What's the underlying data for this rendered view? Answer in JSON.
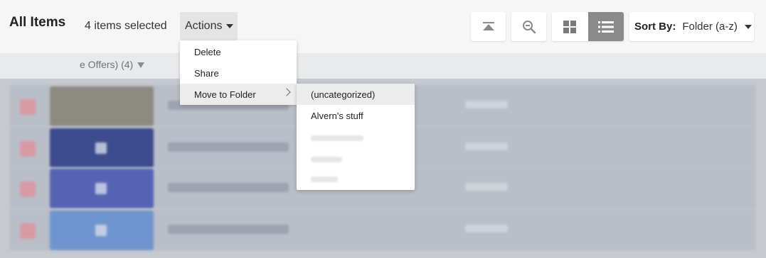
{
  "header": {
    "title": "All Items",
    "selection_count": "4 items selected",
    "actions_label": "Actions"
  },
  "toolbar": {
    "scroll_top_icon": "scroll-to-top-icon",
    "zoom_icon": "zoom-out-icon",
    "grid_view_icon": "grid-view-icon",
    "list_view_icon": "list-view-icon",
    "active_view": "list",
    "sort_label": "Sort By:",
    "sort_value": "Folder (a-z)"
  },
  "group": {
    "label": "e Offers) (4)"
  },
  "actions_menu": {
    "items": [
      {
        "label": "Delete"
      },
      {
        "label": "Share"
      },
      {
        "label": "Move to Folder"
      }
    ]
  },
  "folder_menu": {
    "items": [
      {
        "label": "(uncategorized)"
      },
      {
        "label": "Alvern's stuff"
      }
    ]
  },
  "colors": {
    "accent_active_view": "#8a8a8a",
    "menu_hover": "#ececec",
    "thumb_1": "#8d8a82",
    "thumb_2": "#3c4c8c",
    "thumb_3": "#5563b4",
    "thumb_4": "#6f95cf"
  }
}
